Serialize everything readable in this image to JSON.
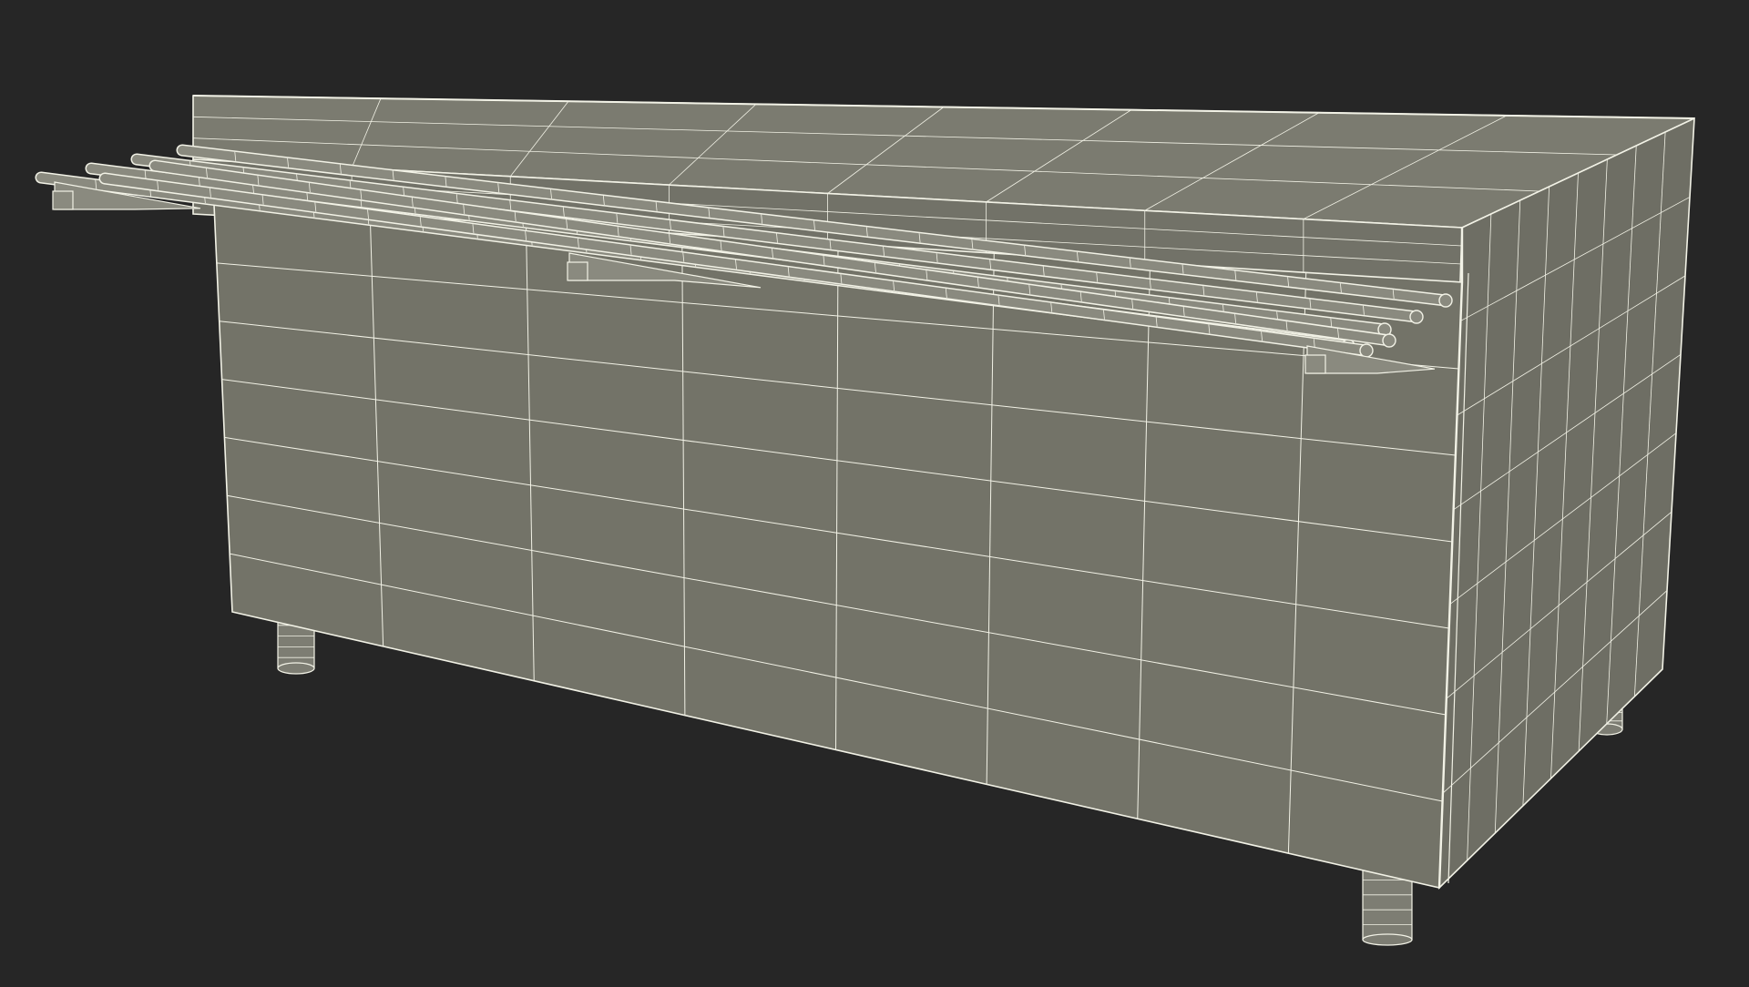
{
  "scene": {
    "subject": "wireframe-counter-with-tray-slide",
    "colors": {
      "background": "#262626",
      "front_face": "#737368",
      "side_face": "#6e6e64",
      "top_face": "#7b7b70",
      "top_band": "#727268",
      "wire": "#f2f2e6",
      "rail": "#8a8a7f",
      "leg": "#7d7d73"
    },
    "grid": {
      "front_columns": 8,
      "front_rows": 7,
      "side_columns": 8,
      "side_rows": 7,
      "top_columns": 8,
      "top_rows": 6
    },
    "tray_slide": {
      "rail_count": 6,
      "bracket_count": 3
    },
    "leg_count": 4
  }
}
